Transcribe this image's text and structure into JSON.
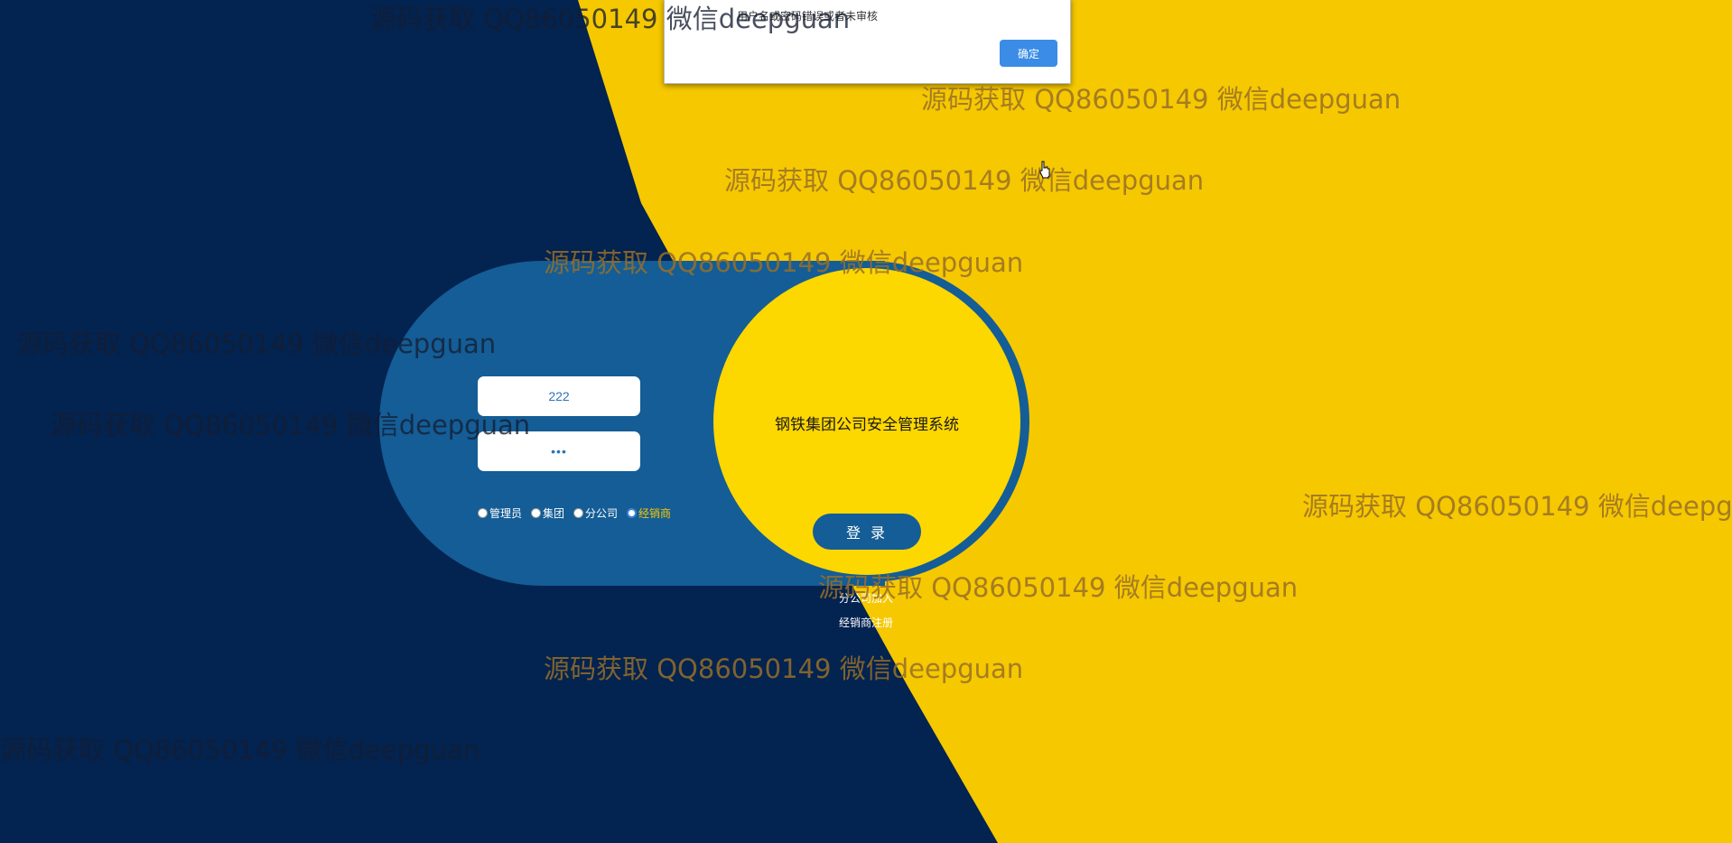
{
  "system": {
    "title": "钢铁集团公司安全管理系统"
  },
  "login": {
    "username_value": "222",
    "password_value": "•••",
    "roles": [
      {
        "label": "管理员",
        "checked": false
      },
      {
        "label": "集团",
        "checked": false
      },
      {
        "label": "分公司",
        "checked": false
      },
      {
        "label": "经销商",
        "checked": true
      }
    ],
    "button_label": "登 录",
    "links": {
      "branch_join": "分公司加入",
      "dealer_register": "经销商注册"
    }
  },
  "dialog": {
    "message": "用户名或密码错误或者未审核",
    "ok_label": "确定"
  },
  "watermark": {
    "text": "源码获取 QQ86050149 微信deepguan"
  },
  "colors": {
    "navy": "#032350",
    "yellow": "#f6c800",
    "panel_blue": "#145d96",
    "circle_yellow": "#fdd700",
    "accent_blue": "#3a8ce6"
  }
}
